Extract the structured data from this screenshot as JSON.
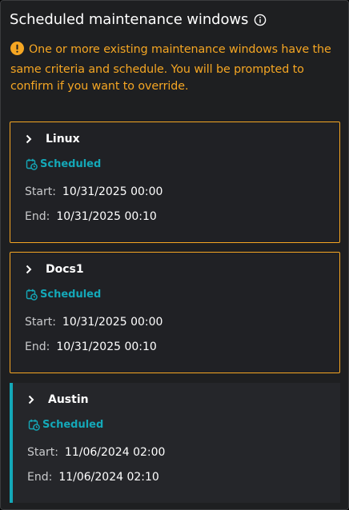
{
  "header": {
    "title": "Scheduled maintenance windows",
    "info_icon": "info-circle-icon"
  },
  "warning": {
    "icon": "warning-circle-icon",
    "text": "One or more existing maintenance windows have the same criteria and schedule. You will be prompted to confirm if you want to override."
  },
  "labels": {
    "start": "Start:",
    "end": "End:"
  },
  "colors": {
    "warning": "#f5a623",
    "status": "#14a8b8",
    "accent": "#14a8b8"
  },
  "windows": [
    {
      "name": "Linux",
      "status": "Scheduled",
      "start": "10/31/2025 00:00",
      "end": "10/31/2025 00:10"
    },
    {
      "name": "Docs1",
      "status": "Scheduled",
      "start": "10/31/2025 00:00",
      "end": "10/31/2025 00:10"
    },
    {
      "name": "Austin",
      "status": "Scheduled",
      "start": "11/06/2024 02:00",
      "end": "11/06/2024 02:10"
    }
  ]
}
